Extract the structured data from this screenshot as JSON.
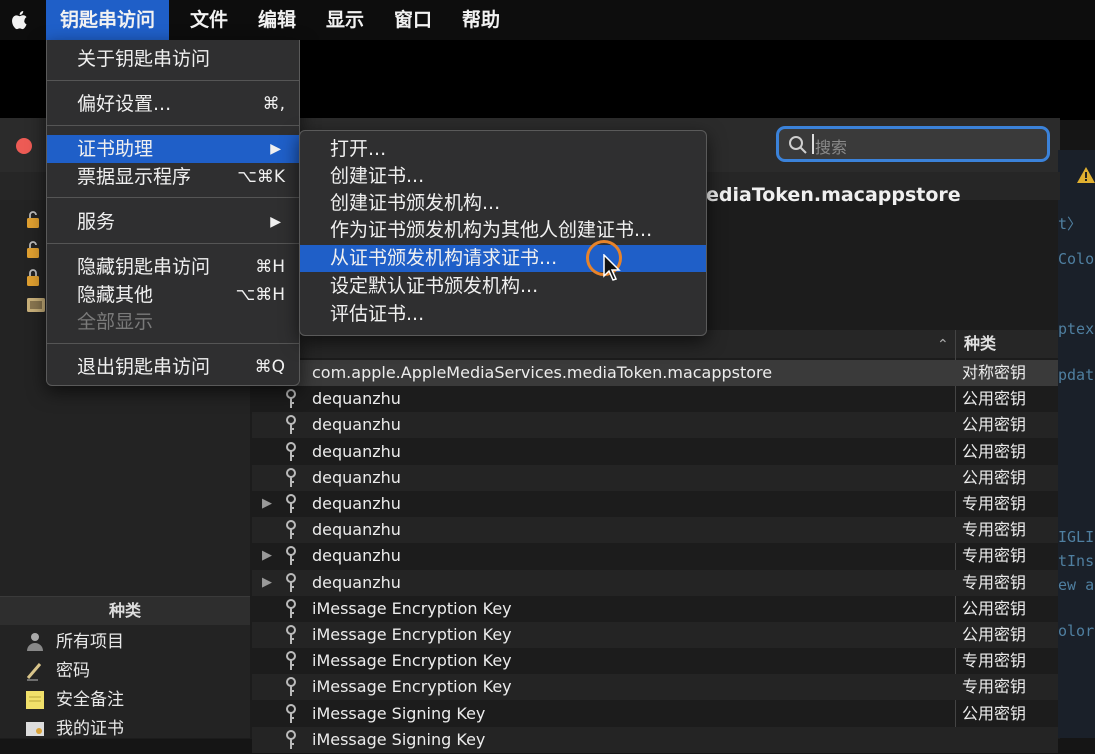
{
  "menubar": {
    "app_menu": "钥匙串访问",
    "items": [
      "文件",
      "编辑",
      "显示",
      "窗口",
      "帮助"
    ]
  },
  "app_menu": {
    "about": "关于钥匙串访问",
    "preferences": "偏好设置...",
    "preferences_shortcut": "⌘,",
    "cert_assistant": "证书助理",
    "ticket_viewer": "票据显示程序",
    "ticket_viewer_shortcut": "⌥⌘K",
    "services": "服务",
    "hide": "隐藏钥匙串访问",
    "hide_shortcut": "⌘H",
    "hide_others": "隐藏其他",
    "hide_others_shortcut": "⌥⌘H",
    "show_all": "全部显示",
    "quit": "退出钥匙串访问",
    "quit_shortcut": "⌘Q"
  },
  "cert_submenu": [
    "打开...",
    "创建证书...",
    "创建证书颁发机构...",
    "作为证书颁发机构为其他人创建证书...",
    "从证书颁发机构请求证书...",
    "设定默认证书颁发机构...",
    "评估证书..."
  ],
  "search": {
    "placeholder": "搜索"
  },
  "selected_item_title": "ediaToken.macappstore",
  "table": {
    "kind_header": "种类",
    "rows": [
      {
        "name": "com.apple.AppleMediaServices.mediaToken.macappstore",
        "kind": "对称密钥",
        "expandable": false
      },
      {
        "name": "dequanzhu",
        "kind": "公用密钥",
        "expandable": false
      },
      {
        "name": "dequanzhu",
        "kind": "公用密钥",
        "expandable": false
      },
      {
        "name": "dequanzhu",
        "kind": "公用密钥",
        "expandable": false
      },
      {
        "name": "dequanzhu",
        "kind": "公用密钥",
        "expandable": false
      },
      {
        "name": "dequanzhu",
        "kind": "专用密钥",
        "expandable": true
      },
      {
        "name": "dequanzhu",
        "kind": "专用密钥",
        "expandable": false
      },
      {
        "name": "dequanzhu",
        "kind": "专用密钥",
        "expandable": true
      },
      {
        "name": "dequanzhu",
        "kind": "专用密钥",
        "expandable": true
      },
      {
        "name": "iMessage Encryption Key",
        "kind": "公用密钥",
        "expandable": false
      },
      {
        "name": "iMessage Encryption Key",
        "kind": "公用密钥",
        "expandable": false
      },
      {
        "name": "iMessage Encryption Key",
        "kind": "专用密钥",
        "expandable": false
      },
      {
        "name": "iMessage Encryption Key",
        "kind": "专用密钥",
        "expandable": false
      },
      {
        "name": "iMessage Signing Key",
        "kind": "公用密钥",
        "expandable": false
      },
      {
        "name": "iMessage Signing Key",
        "kind": "",
        "expandable": false
      }
    ]
  },
  "sidebar": {
    "kind_header": "种类",
    "categories": [
      "所有项目",
      "密码",
      "安全备注",
      "我的证书"
    ]
  },
  "code_fragments": [
    "t〉",
    "Colo",
    "ptex",
    "pdat",
    "IGLI",
    "tIns",
    "ew a",
    "olor"
  ],
  "colors": {
    "accent": "#1f5fc8",
    "close": "#ed5b55",
    "cursor_ring": "#e7832a"
  }
}
